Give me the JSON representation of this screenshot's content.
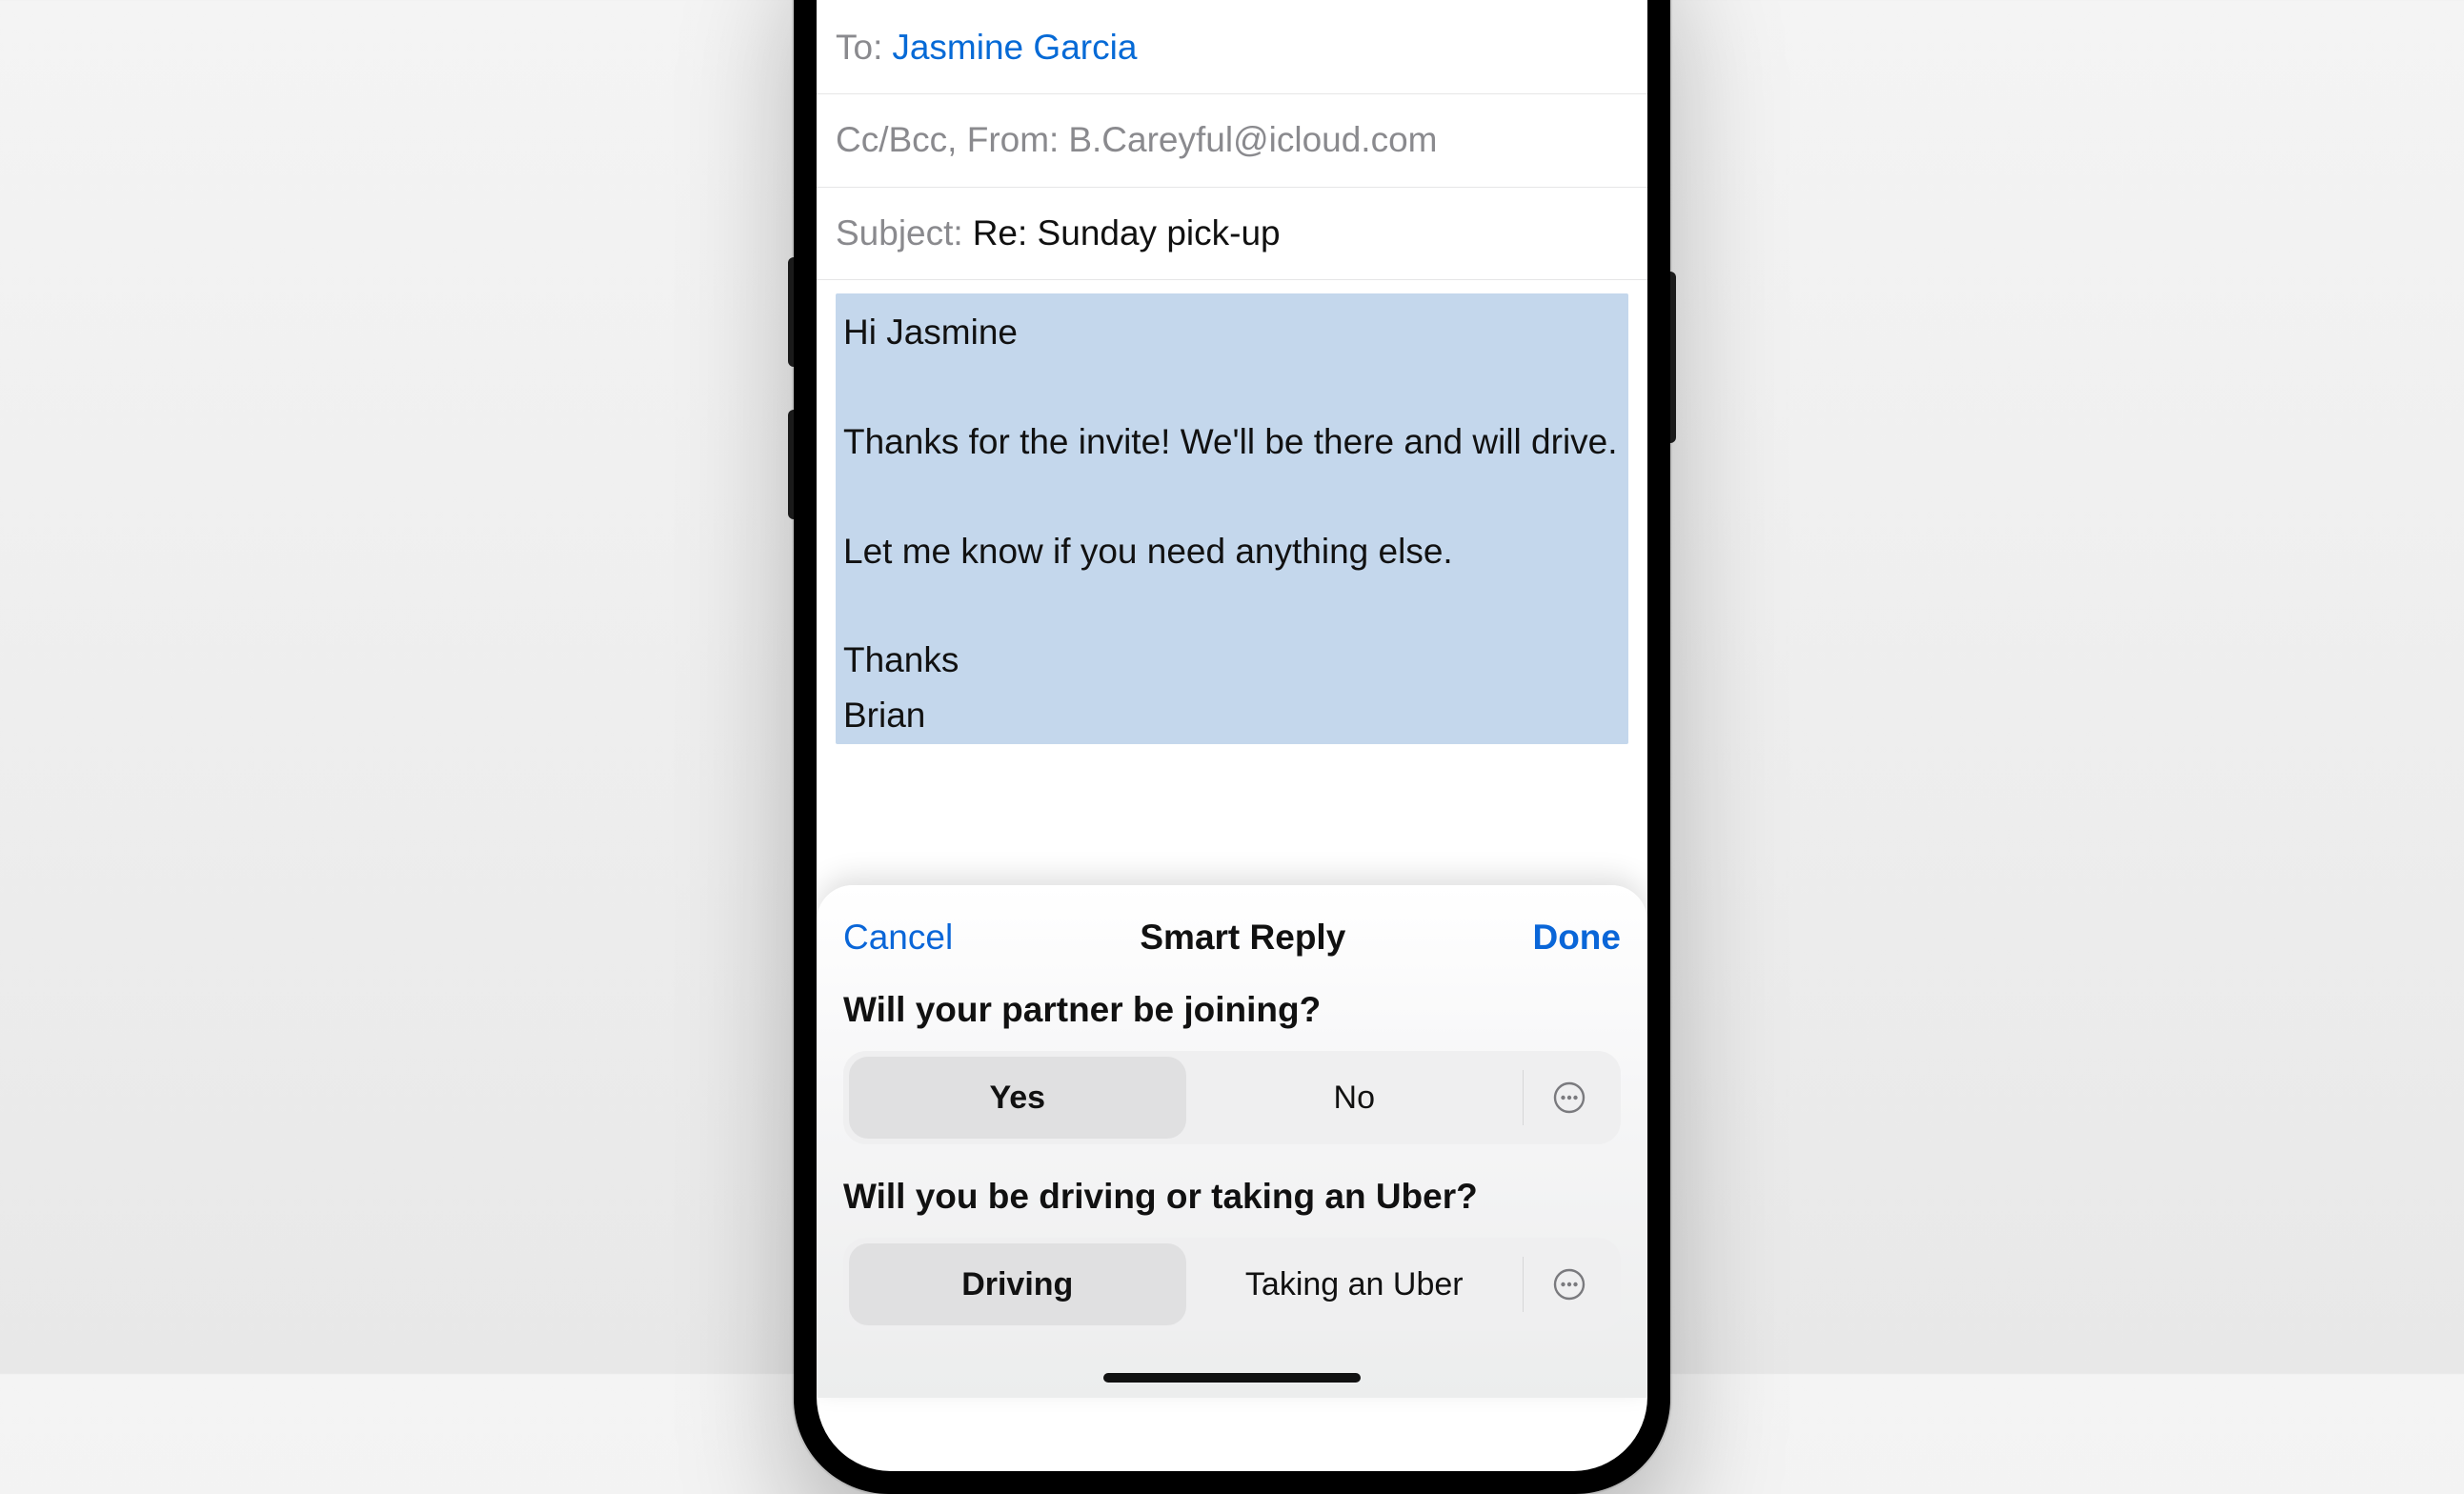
{
  "compose": {
    "to_label": "To:",
    "to_value": "Jasmine Garcia",
    "ccbcc_label": "Cc/Bcc, From:",
    "from_value": "B.Careyful@icloud.com",
    "subject_label": "Subject:",
    "subject_value": "Re: Sunday pick-up",
    "body": "Hi Jasmine\n\nThanks for the invite! We'll be there and will drive.\n\nLet me know if you need anything else.\n\nThanks\nBrian"
  },
  "sheet": {
    "cancel_label": "Cancel",
    "title": "Smart Reply",
    "done_label": "Done",
    "questions": [
      {
        "prompt": "Will your partner be joining?",
        "options": [
          "Yes",
          "No"
        ],
        "selected_index": 0
      },
      {
        "prompt": "Will you be driving or taking an Uber?",
        "options": [
          "Driving",
          "Taking an Uber"
        ],
        "selected_index": 0
      }
    ],
    "more_icon_name": "ellipsis-circle-icon"
  }
}
